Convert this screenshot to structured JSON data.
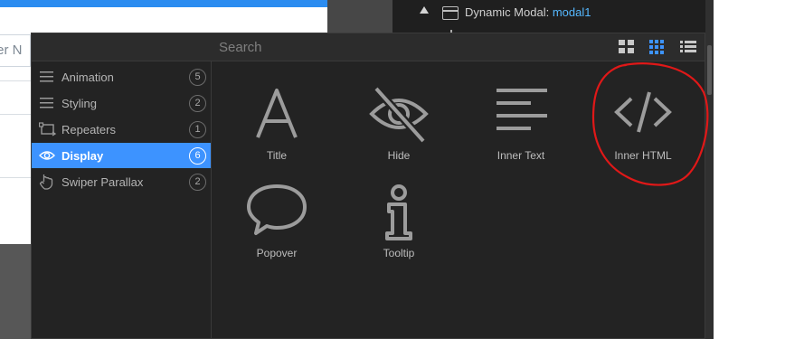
{
  "background": {
    "input_partial_text": "ter N",
    "tree_label": "Dynamic Modal:",
    "tree_value": "modal1"
  },
  "panel": {
    "search": {
      "placeholder": "Search",
      "value": ""
    },
    "view_buttons": [
      {
        "name": "large-grid",
        "active": false
      },
      {
        "name": "medium-grid",
        "active": true
      },
      {
        "name": "list",
        "active": false
      }
    ],
    "categories": [
      {
        "label": "Animation",
        "count": "5",
        "icon": "hamburger-icon",
        "active": false
      },
      {
        "label": "Styling",
        "count": "2",
        "icon": "hamburger-icon",
        "active": false
      },
      {
        "label": "Repeaters",
        "count": "1",
        "icon": "repeat-icon",
        "active": false
      },
      {
        "label": "Display",
        "count": "6",
        "icon": "eye-icon",
        "active": true
      },
      {
        "label": "Swiper Parallax",
        "count": "2",
        "icon": "hand-pointer-icon",
        "active": false
      }
    ],
    "tiles": [
      {
        "label": "Title",
        "icon": "letter-a-icon"
      },
      {
        "label": "Hide",
        "icon": "eye-slash-icon"
      },
      {
        "label": "Inner Text",
        "icon": "text-lines-icon"
      },
      {
        "label": "Inner HTML",
        "icon": "code-icon"
      },
      {
        "label": "Popover",
        "icon": "speech-bubble-icon"
      },
      {
        "label": "Tooltip",
        "icon": "info-icon"
      }
    ]
  },
  "colors": {
    "accent": "#3d93ff",
    "panel_bg": "#232323",
    "annotation": "#e01818"
  }
}
